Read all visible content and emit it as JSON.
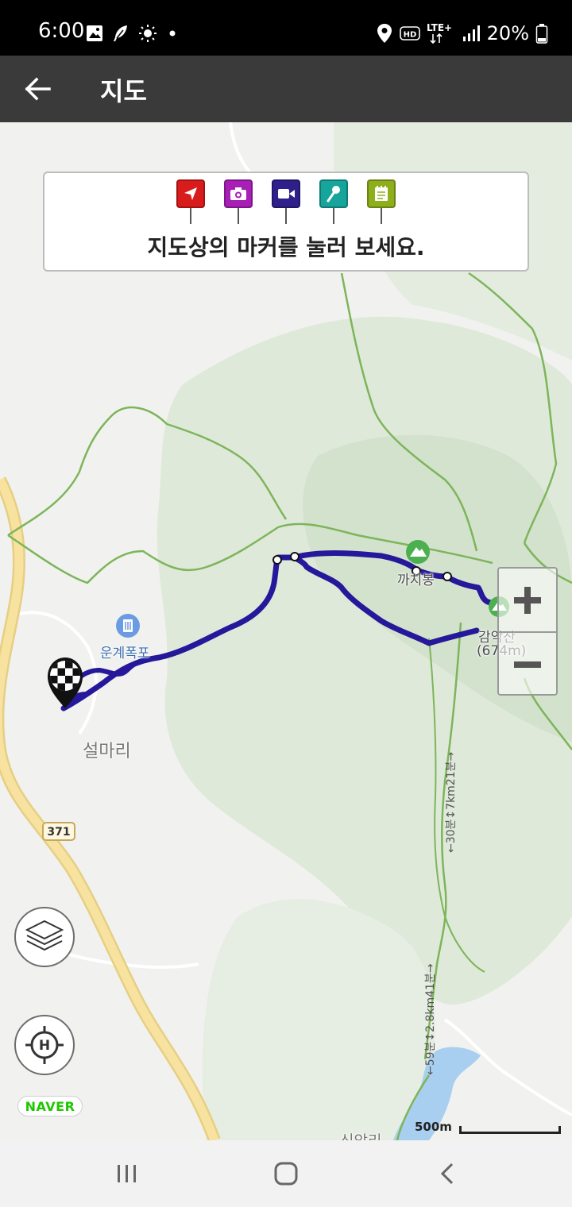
{
  "status_bar": {
    "time": "6:00",
    "battery_percent": "20%",
    "network": "LTE+",
    "icons": [
      "image-icon",
      "feather-icon",
      "sun-icon",
      "dot-icon",
      "location-icon",
      "hd-icon",
      "signal-icon",
      "battery-icon"
    ]
  },
  "app_bar": {
    "title": "지도",
    "back_icon": "back-arrow-icon"
  },
  "legend": {
    "text": "지도상의 마커를 눌러 보세요.",
    "markers": [
      {
        "name": "navigation-marker-icon",
        "color": "#d81b1b"
      },
      {
        "name": "camera-marker-icon",
        "color": "#a71fb5"
      },
      {
        "name": "video-marker-icon",
        "color": "#2e1f8a"
      },
      {
        "name": "microphone-marker-icon",
        "color": "#16a49b"
      },
      {
        "name": "memo-marker-icon",
        "color": "#8fae1b"
      }
    ]
  },
  "map": {
    "labels": {
      "waterfall": "운계폭포",
      "village": "설마리",
      "peak": "까치봉",
      "mountain_name": "감악산",
      "mountain_elevation": "(674m)",
      "road_number": "371",
      "south_village": "신암리",
      "trail_info_1": "←30분↕7km21분→",
      "trail_info_2": "←59분↕2.8km41분→"
    },
    "colors": {
      "track": "#25189a",
      "road": "#f6df90",
      "boundary": "#7db55a",
      "water": "#a9cff0",
      "forest": "#d9e6d4"
    }
  },
  "zoom": {
    "in_icon": "plus-icon",
    "out_icon": "minus-icon"
  },
  "controls": {
    "layers_icon": "layers-icon",
    "home_icon": "crosshair-home-icon",
    "home_glyph": "H"
  },
  "branding": {
    "naver": "NAVER"
  },
  "scale": {
    "label": "500m"
  },
  "nav_bar": {
    "recent_icon": "recent-apps-icon",
    "home_icon": "home-icon",
    "back_icon": "back-icon"
  }
}
